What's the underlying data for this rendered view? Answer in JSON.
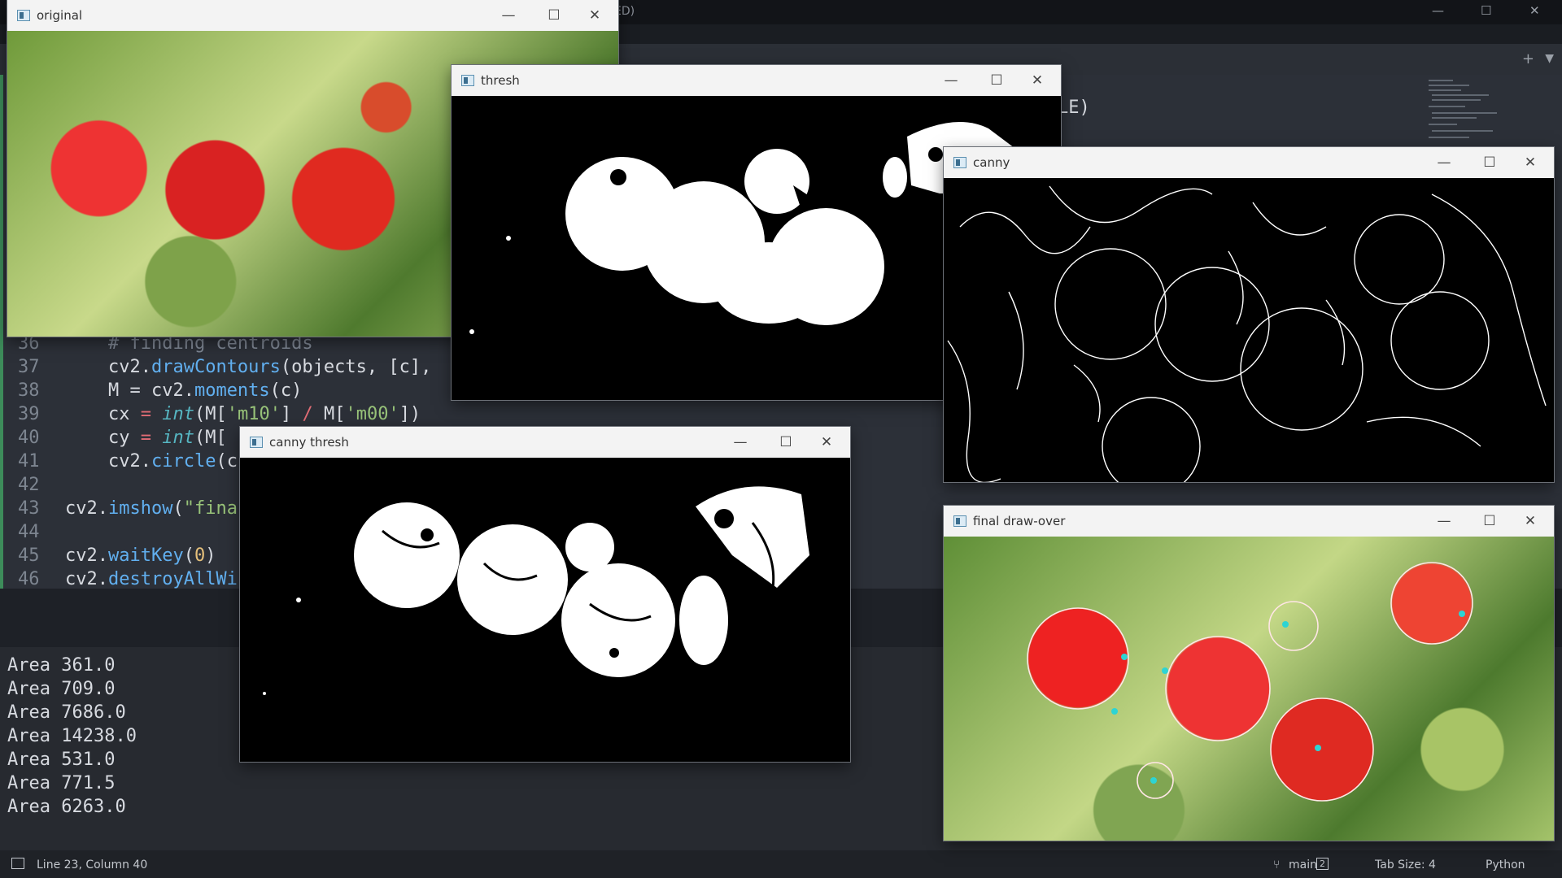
{
  "editor": {
    "title_fragment": "ED)",
    "code_fragment_right": "LE)",
    "lines": [
      {
        "num": "36",
        "parts": [
          {
            "t": "    ",
            "c": "kw"
          },
          {
            "t": "# finding centroids",
            "c": "cm"
          }
        ]
      },
      {
        "num": "37",
        "parts": [
          {
            "t": "    cv2.",
            "c": "kw"
          },
          {
            "t": "drawContours",
            "c": "fn"
          },
          {
            "t": "(objects, [c],",
            "c": "kw"
          }
        ]
      },
      {
        "num": "38",
        "parts": [
          {
            "t": "    M = cv2.",
            "c": "kw"
          },
          {
            "t": "moments",
            "c": "fn"
          },
          {
            "t": "(c)",
            "c": "kw"
          }
        ]
      },
      {
        "num": "39",
        "parts": [
          {
            "t": "    cx ",
            "c": "kw"
          },
          {
            "t": "=",
            "c": "op"
          },
          {
            "t": " ",
            "c": "kw"
          },
          {
            "t": "int",
            "c": "it"
          },
          {
            "t": "(M[",
            "c": "kw"
          },
          {
            "t": "'m10'",
            "c": "str"
          },
          {
            "t": "] ",
            "c": "kw"
          },
          {
            "t": "/",
            "c": "op"
          },
          {
            "t": " M[",
            "c": "kw"
          },
          {
            "t": "'m00'",
            "c": "str"
          },
          {
            "t": "])",
            "c": "kw"
          }
        ]
      },
      {
        "num": "40",
        "parts": [
          {
            "t": "    cy ",
            "c": "kw"
          },
          {
            "t": "=",
            "c": "op"
          },
          {
            "t": " ",
            "c": "kw"
          },
          {
            "t": "int",
            "c": "it"
          },
          {
            "t": "(M[",
            "c": "kw"
          }
        ]
      },
      {
        "num": "41",
        "parts": [
          {
            "t": "    cv2.",
            "c": "kw"
          },
          {
            "t": "circle",
            "c": "fn"
          },
          {
            "t": "(c",
            "c": "kw"
          }
        ]
      },
      {
        "num": "42",
        "parts": []
      },
      {
        "num": "43",
        "parts": [
          {
            "t": "cv2.",
            "c": "kw"
          },
          {
            "t": "imshow",
            "c": "fn"
          },
          {
            "t": "(",
            "c": "kw"
          },
          {
            "t": "\"fina",
            "c": "str"
          }
        ]
      },
      {
        "num": "44",
        "parts": []
      },
      {
        "num": "45",
        "parts": [
          {
            "t": "cv2.",
            "c": "kw"
          },
          {
            "t": "waitKey",
            "c": "fn"
          },
          {
            "t": "(",
            "c": "kw"
          },
          {
            "t": "0",
            "c": "num"
          },
          {
            "t": ")",
            "c": "kw"
          }
        ]
      },
      {
        "num": "46",
        "parts": [
          {
            "t": "cv2.",
            "c": "kw"
          },
          {
            "t": "destroyAllWi",
            "c": "fn"
          }
        ]
      }
    ]
  },
  "output": {
    "lines": [
      "Area 361.0",
      "Area 709.0",
      "Area 7686.0",
      "Area 14238.0",
      "Area 531.0",
      "Area 771.5",
      "Area 6263.0"
    ]
  },
  "status": {
    "position": "Line 23, Column 40",
    "branch": "main",
    "branch_count": "2",
    "tab_size": "Tab Size: 4",
    "language": "Python"
  },
  "windows": {
    "original": {
      "title": "original"
    },
    "thresh": {
      "title": "thresh"
    },
    "canny": {
      "title": "canny"
    },
    "canny_thresh": {
      "title": "canny thresh"
    },
    "final": {
      "title": "final draw-over"
    }
  },
  "controls": {
    "minimize": "—",
    "maximize": "☐",
    "close": "✕",
    "plus": "+",
    "dropdown": "▼"
  },
  "colors": {
    "accent_green": "#3d8c5a",
    "centroid": "#2dd4d4",
    "code_bg": "#2c3038",
    "titlebar_bg": "#f3f3f3"
  }
}
